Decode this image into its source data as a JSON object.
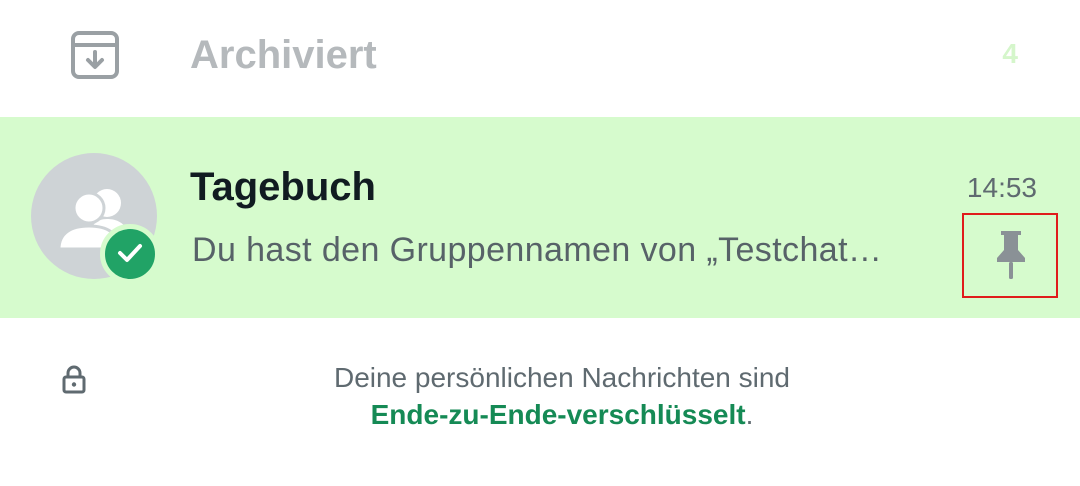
{
  "archived": {
    "icon": "archive-icon",
    "label": "Archiviert",
    "count": "4",
    "count_color": "#d5f6cb"
  },
  "chat": {
    "title": "Tagebuch",
    "time": "14:53",
    "preview": "Du hast den Gruppennamen von „Testchat…",
    "avatar_icon": "group-icon",
    "selected_icon": "check-icon",
    "pin_icon": "pin-icon",
    "selected": true,
    "pinned": true,
    "background": "#d6fbcd"
  },
  "encryption_notice": {
    "icon": "lock-icon",
    "line1": "Deine persönlichen Nachrichten sind",
    "link": "Ende-zu-Ende-verschlüsselt",
    "suffix": ".",
    "link_color": "#158a55"
  }
}
